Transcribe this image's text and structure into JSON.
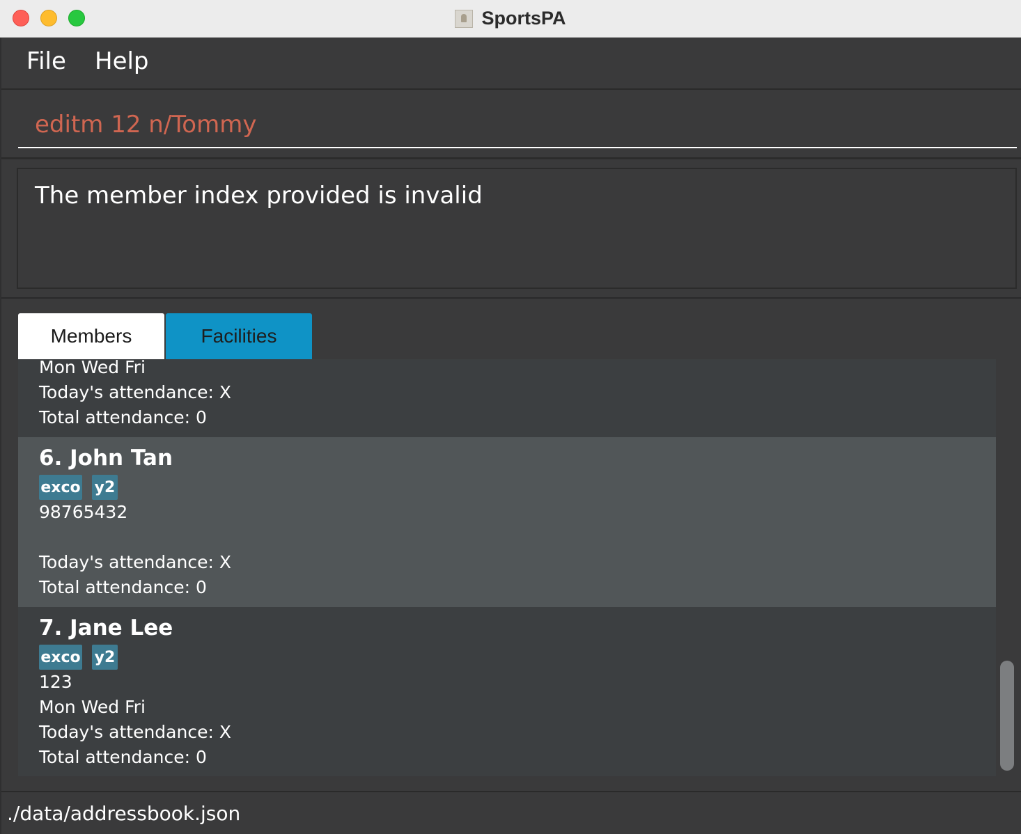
{
  "window": {
    "title": "SportsPA"
  },
  "menu": {
    "file_label": "File",
    "help_label": "Help"
  },
  "command": {
    "value": "editm 12 n/Tommy"
  },
  "result": {
    "message": "The member index provided is invalid"
  },
  "tabs": [
    {
      "label": "Members",
      "selected": true
    },
    {
      "label": "Facilities",
      "selected": false
    }
  ],
  "members": {
    "partial_card": {
      "days": "Mon Wed Fri",
      "today_attendance": "Today's attendance: X",
      "total_attendance": "Total attendance: 0"
    },
    "cards": [
      {
        "index_name": "6.  John Tan",
        "tags": [
          "exco",
          "y2"
        ],
        "phone": "98765432",
        "days": "",
        "today_attendance": "Today's attendance: X",
        "total_attendance": "Total attendance: 0",
        "selected": true
      },
      {
        "index_name": "7.  Jane Lee",
        "tags": [
          "exco",
          "y2"
        ],
        "phone": "123",
        "days": "Mon Wed Fri",
        "today_attendance": "Today's attendance: X",
        "total_attendance": "Total attendance: 0",
        "selected": false
      }
    ]
  },
  "status": {
    "file_path": "./data/addressbook.json"
  },
  "colors": {
    "command_text": "#d06651",
    "tab_facilities": "#0f93c6",
    "tag": "#3e7b91",
    "selected_card": "#515658"
  }
}
